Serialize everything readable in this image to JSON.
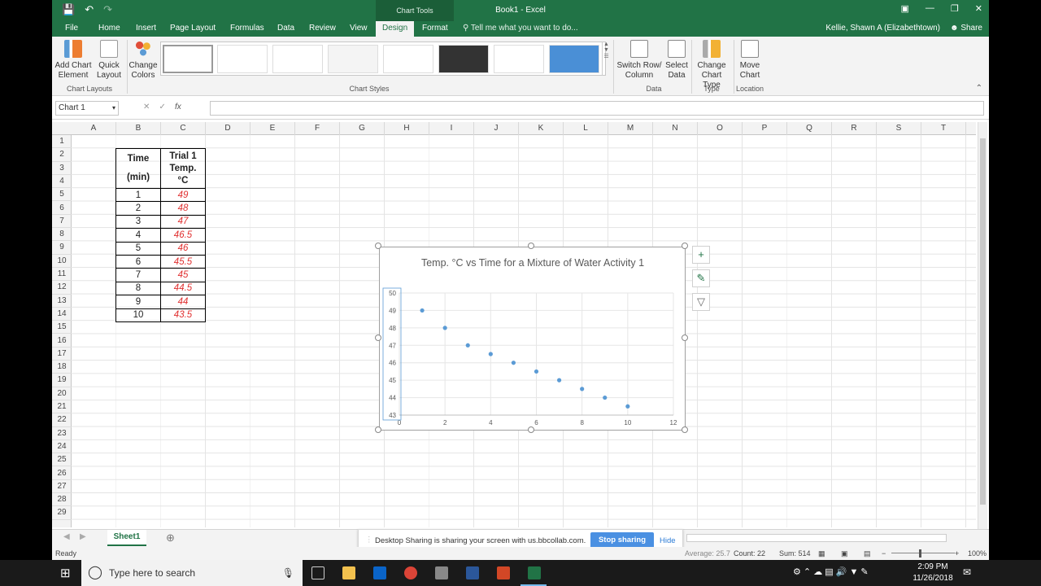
{
  "app": {
    "title": "Book1 - Excel",
    "context_tab": "Chart Tools",
    "user": "Kellie, Shawn A (Elizabethtown)",
    "share": "Share",
    "tell_me": "Tell me what you want to do..."
  },
  "tabs": [
    "File",
    "Home",
    "Insert",
    "Page Layout",
    "Formulas",
    "Data",
    "Review",
    "View",
    "Design",
    "Format"
  ],
  "ribbon": {
    "add_chart_element": "Add Chart Element",
    "quick_layout": "Quick Layout",
    "change_colors": "Change Colors",
    "switch_row_col": "Switch Row/ Column",
    "select_data": "Select Data",
    "change_chart_type": "Change Chart Type",
    "move_chart": "Move Chart",
    "groups": {
      "chart_layouts": "Chart Layouts",
      "chart_styles": "Chart Styles",
      "data": "Data",
      "type": "Type",
      "location": "Location"
    }
  },
  "formula_bar": {
    "name_box": "Chart 1",
    "fx": "fx",
    "value": ""
  },
  "columns": [
    "A",
    "B",
    "C",
    "D",
    "E",
    "F",
    "G",
    "H",
    "I",
    "J",
    "K",
    "L",
    "M",
    "N",
    "O",
    "P",
    "Q",
    "R",
    "S",
    "T"
  ],
  "rows": [
    "1",
    "2",
    "3",
    "4",
    "5",
    "6",
    "7",
    "8",
    "9",
    "10",
    "11",
    "12",
    "13",
    "14",
    "15",
    "16",
    "17",
    "18",
    "19",
    "20",
    "21",
    "22",
    "23",
    "24",
    "25",
    "26",
    "27",
    "28",
    "29"
  ],
  "table": {
    "header_time": [
      "Time",
      "(min)"
    ],
    "header_temp": [
      "Trial 1",
      "Temp.",
      "°C"
    ],
    "time": [
      "1",
      "2",
      "3",
      "4",
      "5",
      "6",
      "7",
      "8",
      "9",
      "10"
    ],
    "temp": [
      "49",
      "48",
      "47",
      "46.5",
      "46",
      "45.5",
      "45",
      "44.5",
      "44",
      "43.5"
    ]
  },
  "chart_data": {
    "type": "scatter",
    "title": "Temp. °C vs Time for a Mixture of Water Activity 1",
    "x": [
      1,
      2,
      3,
      4,
      5,
      6,
      7,
      8,
      9,
      10
    ],
    "y": [
      49,
      48,
      47,
      46.5,
      46,
      45.5,
      45,
      44.5,
      44,
      43.5
    ],
    "xlim": [
      0,
      12
    ],
    "ylim": [
      43,
      50
    ],
    "xticks": [
      "0",
      "2",
      "4",
      "6",
      "8",
      "10",
      "12"
    ],
    "yticks": [
      "43",
      "44",
      "45",
      "46",
      "47",
      "48",
      "49",
      "50"
    ],
    "color": "#5b9bd5",
    "grid": true
  },
  "sheet": {
    "tab": "Sheet1"
  },
  "sharing": {
    "message": "Desktop Sharing is sharing your screen with us.bbcollab.com.",
    "stop": "Stop sharing",
    "hide": "Hide"
  },
  "status": {
    "ready": "Ready",
    "average": "Average: 25.7",
    "count": "Count: 22",
    "sum": "Sum: 514",
    "zoom": "100%"
  },
  "taskbar": {
    "search_placeholder": "Type here to search",
    "time": "2:09 PM",
    "date": "11/26/2018"
  },
  "colors": {
    "excel_green": "#217346",
    "chart_point": "#5b9bd5",
    "temp_text": "#e03030"
  }
}
